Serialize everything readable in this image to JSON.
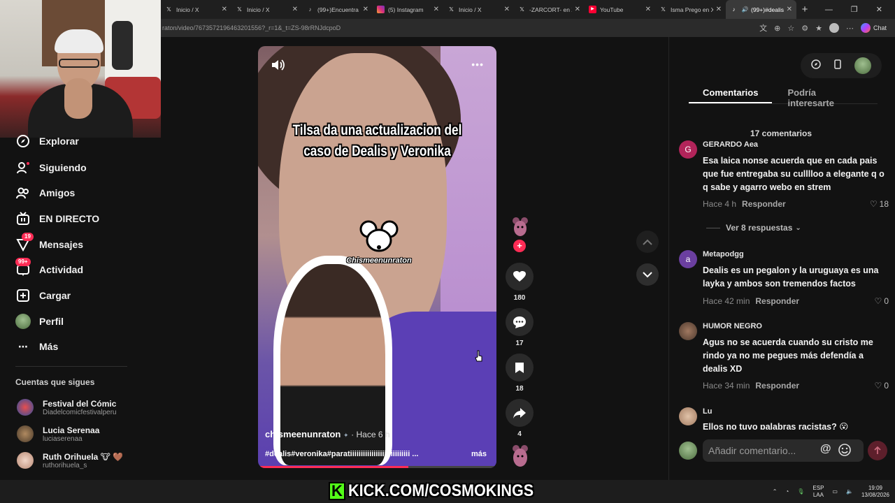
{
  "browser": {
    "tabs": [
      {
        "label": "Inicio / X",
        "icon": "x-logo-icon"
      },
      {
        "label": "Inicio / X",
        "icon": "x-logo-icon"
      },
      {
        "label": "(99+)Encuentra 'p",
        "icon": "tiktok-icon"
      },
      {
        "label": "(5) Instagram",
        "icon": "instagram-icon"
      },
      {
        "label": "Inicio / X",
        "icon": "x-logo-icon"
      },
      {
        "label": "-ZARCORT- en X",
        "icon": "x-logo-icon"
      },
      {
        "label": "YouTube",
        "icon": "youtube-icon"
      },
      {
        "label": "Isma Prego en X",
        "icon": "x-logo-icon"
      },
      {
        "label": "(99+)#dealis",
        "icon": "tiktok-icon",
        "active": true
      }
    ],
    "url": "raton/video/7673572196463201556?_r=1&_t=ZS-98rRNJdcpoD",
    "chat_label": "Chat"
  },
  "sidebar": {
    "nav": [
      {
        "label": "Explorar",
        "icon": "compass-icon"
      },
      {
        "label": "Siguiendo",
        "icon": "following-icon"
      },
      {
        "label": "Amigos",
        "icon": "friends-icon"
      },
      {
        "label": "EN DIRECTO",
        "icon": "live-icon"
      },
      {
        "label": "Mensajes",
        "icon": "messages-icon",
        "badge": "19"
      },
      {
        "label": "Actividad",
        "icon": "activity-icon",
        "badge": "99+"
      },
      {
        "label": "Cargar",
        "icon": "upload-icon"
      },
      {
        "label": "Perfil",
        "icon": "profile-avatar"
      },
      {
        "label": "Más",
        "icon": "more-icon"
      }
    ],
    "following_title": "Cuentas que sigues",
    "following": [
      {
        "name": "Festival del Cómic",
        "user": "Diadelcomicfestivalperu"
      },
      {
        "name": "Lucia Serenaa",
        "user": "luciaserenaa"
      },
      {
        "name": "Ruth Orihuela 🐮 🤎",
        "user": "ruthorihuela_s"
      }
    ]
  },
  "video": {
    "overlay_title_line1": "Tilsa da una actualizacion  del",
    "overlay_title_line2": "caso de Dealis y Veronika",
    "logo_text": "Chismeenunraton",
    "author": "chismeenunraton",
    "time": "· Hace 6 h",
    "description": "#dealis#veronika#paratiiiiiiiiiiiiiiiiiiiiiiiiiiii ...",
    "more": "más",
    "progress": 0.63
  },
  "actions": {
    "likes": "180",
    "comments": "17",
    "saves": "18",
    "shares": "4"
  },
  "comments_panel": {
    "tab_comments": "Comentarios",
    "tab_interest": "Podría interesarte",
    "count_label": "17 comentarios",
    "comments": [
      {
        "initial": "G",
        "user": "GERARDO Aea",
        "text": "Esa laica nonse acuerda que en cada pais que fue entregaba su culllloo a elegante q o q sabe y agarro webo en strem",
        "time": "Hace 4 h",
        "reply": "Responder",
        "likes": "18",
        "color": "#b2245a"
      },
      {
        "initial": "a",
        "user": "Metapodgg",
        "text": "Dealis es un pegalon y la uruguaya es una layka y ambos son tremendos factos",
        "time": "Hace 42 min",
        "reply": "Responder",
        "likes": "0",
        "color": "#6b3fa0"
      },
      {
        "initial": "",
        "user": "HUMOR NEGRO",
        "text": "Agus no se acuerda cuando su cristo me rindo ya no me pegues más defendía a dealis XD",
        "time": "Hace 34 min",
        "reply": "Responder",
        "likes": "0",
        "color": "#6e5040"
      },
      {
        "initial": "",
        "user": "Lu",
        "text": "Ellos no tuvo palabras racistas? 😮",
        "time": "",
        "reply": "",
        "likes": "",
        "color": "#c8a48a"
      }
    ],
    "view_replies": "Ver 8 respuestas",
    "add_placeholder": "Añadir comentario..."
  },
  "stream": {
    "banner_k": "K",
    "banner_text": "KICK.COM/COSMOKINGS"
  },
  "taskbar": {
    "lang_top": "ESP",
    "lang_bottom": "LAA",
    "clock_time": "19:09",
    "clock_date": "13/08/2026"
  },
  "colors": {
    "accent": "#fe2c55",
    "kick_green": "#53fc18"
  }
}
